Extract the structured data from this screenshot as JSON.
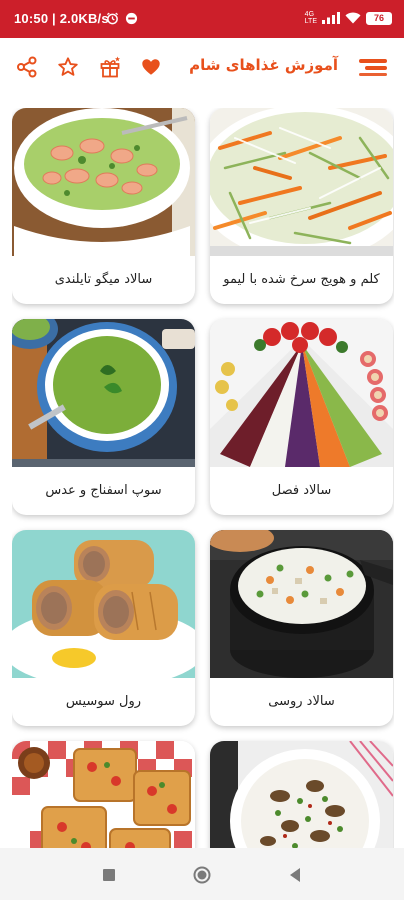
{
  "status_bar": {
    "time": "10:50 | 2.0KB/s",
    "network": "4G",
    "network_sub": "LTE",
    "battery": "76"
  },
  "app_bar": {
    "title": "آموزش غذاهای شام",
    "menu_icon": "menu-icon",
    "icons": [
      "share-icon",
      "star-icon",
      "gift-icon",
      "heart-icon"
    ]
  },
  "colors": {
    "status_bar": "#cc1f2a",
    "accent": "#e8501c",
    "card_text": "#222222"
  },
  "recipes": [
    {
      "title": "کلم و هویج سرخ شده با لیمو",
      "image": "cabbage-carrot-salad"
    },
    {
      "title": "سالاد میگو تایلندی",
      "image": "shrimp-salad"
    },
    {
      "title": "سالاد فصل",
      "image": "season-salad"
    },
    {
      "title": "سوپ اسفناج و عدس",
      "image": "spinach-soup"
    },
    {
      "title": "سالاد روسی",
      "image": "russian-salad"
    },
    {
      "title": "رول سوسیس",
      "image": "sausage-roll"
    },
    {
      "title": "",
      "image": "eggplant-yogurt"
    },
    {
      "title": "",
      "image": "mini-pizza"
    }
  ],
  "nav_bar": {
    "icons": [
      "recents-icon",
      "home-icon",
      "back-icon"
    ]
  }
}
